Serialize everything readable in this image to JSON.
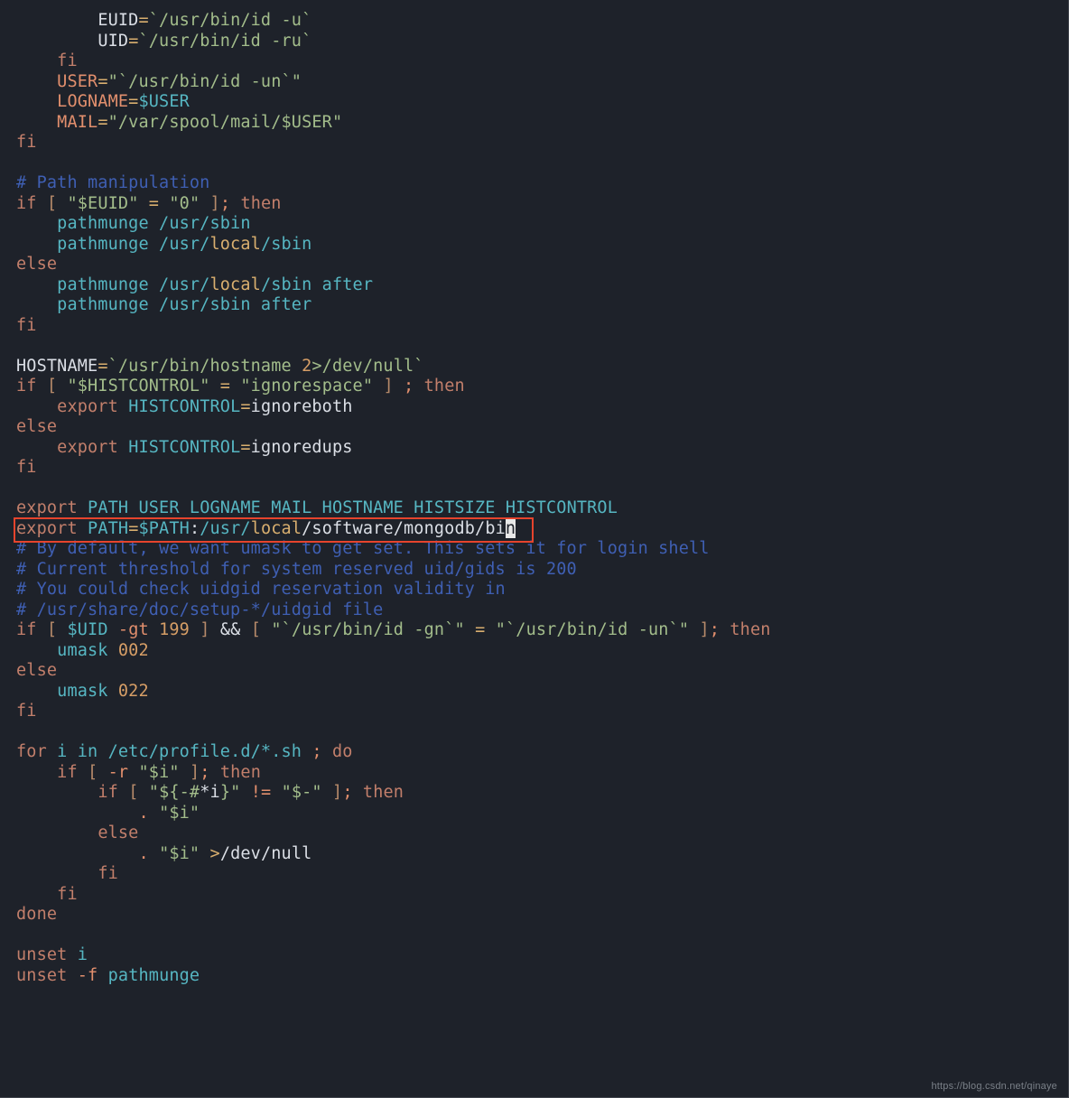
{
  "colors": {
    "background": "#1e222a",
    "keyword": "#c27f6b",
    "string": "#a3bd8b",
    "teal": "#56b6c2",
    "number": "#d69e66",
    "comment": "#3f5fb3",
    "yellow": "#d9af6f",
    "highlight_border": "#e6442d"
  },
  "watermark": "https://blog.csdn.net/qinaye",
  "highlight_box": {
    "top_line": 27,
    "left_ch": 0,
    "width_ch": 55
  },
  "lines": [
    {
      "indent": 8,
      "tokens": [
        [
          "id",
          "EUID"
        ],
        [
          "yl",
          "="
        ],
        [
          "str",
          "`/usr/bin/id -u`"
        ]
      ]
    },
    {
      "indent": 8,
      "tokens": [
        [
          "id",
          "UID"
        ],
        [
          "yl",
          "="
        ],
        [
          "str",
          "`/usr/bin/id -ru`"
        ]
      ]
    },
    {
      "indent": 4,
      "tokens": [
        [
          "kw",
          "fi"
        ]
      ]
    },
    {
      "indent": 4,
      "tokens": [
        [
          "tan",
          "USER"
        ],
        [
          "yl",
          "="
        ],
        [
          "str",
          "\"`/usr/bin/id -un`\""
        ]
      ]
    },
    {
      "indent": 4,
      "tokens": [
        [
          "tan",
          "LOGNAME"
        ],
        [
          "yl",
          "="
        ],
        [
          "teal",
          "$USER"
        ]
      ]
    },
    {
      "indent": 4,
      "tokens": [
        [
          "tan",
          "MAIL"
        ],
        [
          "yl",
          "="
        ],
        [
          "str",
          "\"/var/spool/mail/$USER\""
        ]
      ]
    },
    {
      "indent": 0,
      "tokens": [
        [
          "kw",
          "fi"
        ]
      ]
    },
    {
      "indent": 0,
      "tokens": []
    },
    {
      "indent": 0,
      "tokens": [
        [
          "cmt",
          "# Path manipulation"
        ]
      ]
    },
    {
      "indent": 0,
      "tokens": [
        [
          "kw",
          "if"
        ],
        [
          "pl",
          " "
        ],
        [
          "br",
          "["
        ],
        [
          "pl",
          " "
        ],
        [
          "str",
          "\"$EUID\""
        ],
        [
          "pl",
          " "
        ],
        [
          "yl",
          "="
        ],
        [
          "pl",
          " "
        ],
        [
          "str",
          "\"0\""
        ],
        [
          "pl",
          " "
        ],
        [
          "br",
          "]"
        ],
        [
          "tan",
          ";"
        ],
        [
          "pl",
          " "
        ],
        [
          "kw",
          "then"
        ]
      ]
    },
    {
      "indent": 4,
      "tokens": [
        [
          "teal",
          "pathmunge /usr/sbin"
        ]
      ]
    },
    {
      "indent": 4,
      "tokens": [
        [
          "teal",
          "pathmunge /usr/"
        ],
        [
          "yl",
          "local"
        ],
        [
          "teal",
          "/sbin"
        ]
      ]
    },
    {
      "indent": 0,
      "tokens": [
        [
          "kw",
          "else"
        ]
      ]
    },
    {
      "indent": 4,
      "tokens": [
        [
          "teal",
          "pathmunge /usr/"
        ],
        [
          "yl",
          "local"
        ],
        [
          "teal",
          "/sbin after"
        ]
      ]
    },
    {
      "indent": 4,
      "tokens": [
        [
          "teal",
          "pathmunge /usr/sbin after"
        ]
      ]
    },
    {
      "indent": 0,
      "tokens": [
        [
          "kw",
          "fi"
        ]
      ]
    },
    {
      "indent": 0,
      "tokens": []
    },
    {
      "indent": 0,
      "tokens": [
        [
          "id",
          "HOSTNAME"
        ],
        [
          "yl",
          "="
        ],
        [
          "str",
          "`/usr/bin/hostname "
        ],
        [
          "num",
          "2"
        ],
        [
          "str",
          ">/dev/null`"
        ]
      ]
    },
    {
      "indent": 0,
      "tokens": [
        [
          "kw",
          "if"
        ],
        [
          "pl",
          " "
        ],
        [
          "br",
          "["
        ],
        [
          "pl",
          " "
        ],
        [
          "str",
          "\"$HISTCONTROL\""
        ],
        [
          "pl",
          " "
        ],
        [
          "yl",
          "="
        ],
        [
          "pl",
          " "
        ],
        [
          "str",
          "\"ignorespace\""
        ],
        [
          "pl",
          " "
        ],
        [
          "br",
          "]"
        ],
        [
          "pl",
          " "
        ],
        [
          "tan",
          ";"
        ],
        [
          "pl",
          " "
        ],
        [
          "kw",
          "then"
        ]
      ]
    },
    {
      "indent": 4,
      "tokens": [
        [
          "kw",
          "export"
        ],
        [
          "pl",
          " "
        ],
        [
          "teal",
          "HISTCONTROL"
        ],
        [
          "yl",
          "="
        ],
        [
          "id",
          "ignoreboth"
        ]
      ]
    },
    {
      "indent": 0,
      "tokens": [
        [
          "kw",
          "else"
        ]
      ]
    },
    {
      "indent": 4,
      "tokens": [
        [
          "kw",
          "export"
        ],
        [
          "pl",
          " "
        ],
        [
          "teal",
          "HISTCONTROL"
        ],
        [
          "yl",
          "="
        ],
        [
          "id",
          "ignoredups"
        ]
      ]
    },
    {
      "indent": 0,
      "tokens": [
        [
          "kw",
          "fi"
        ]
      ]
    },
    {
      "indent": 0,
      "tokens": []
    },
    {
      "indent": 0,
      "tokens": [
        [
          "kw",
          "export"
        ],
        [
          "pl",
          " "
        ],
        [
          "teal",
          "PATH USER LOGNAME MAIL HOSTNAME HISTSIZE HISTCONTROL"
        ]
      ]
    },
    {
      "indent": 0,
      "tokens": [
        [
          "kw",
          "export"
        ],
        [
          "pl",
          " "
        ],
        [
          "teal",
          "PATH"
        ],
        [
          "yl",
          "="
        ],
        [
          "teal",
          "$PATH"
        ],
        [
          "id",
          ":"
        ],
        [
          "teal",
          "/usr/"
        ],
        [
          "yl",
          "local"
        ],
        [
          "id",
          "/software/mongodb/bi"
        ],
        [
          "cursor",
          "n"
        ]
      ]
    },
    {
      "indent": 0,
      "tokens": [
        [
          "cmt",
          "# By default, we want umask to get set. This sets it for login shell"
        ]
      ]
    },
    {
      "indent": 0,
      "tokens": [
        [
          "cmt",
          "# Current threshold for system reserved uid/gids is 200"
        ]
      ]
    },
    {
      "indent": 0,
      "tokens": [
        [
          "cmt",
          "# You could check uidgid reservation validity in"
        ]
      ]
    },
    {
      "indent": 0,
      "tokens": [
        [
          "cmt",
          "# /usr/share/doc/setup-*/uidgid file"
        ]
      ]
    },
    {
      "indent": 0,
      "tokens": [
        [
          "kw",
          "if"
        ],
        [
          "pl",
          " "
        ],
        [
          "br",
          "["
        ],
        [
          "pl",
          " "
        ],
        [
          "teal",
          "$UID"
        ],
        [
          "pl",
          " "
        ],
        [
          "tan",
          "-gt"
        ],
        [
          "pl",
          " "
        ],
        [
          "num",
          "199"
        ],
        [
          "pl",
          " "
        ],
        [
          "br",
          "]"
        ],
        [
          "pl",
          " "
        ],
        [
          "id",
          "&&"
        ],
        [
          "pl",
          " "
        ],
        [
          "br",
          "["
        ],
        [
          "pl",
          " "
        ],
        [
          "str",
          "\"`/usr/bin/id -gn`\""
        ],
        [
          "pl",
          " "
        ],
        [
          "yl",
          "="
        ],
        [
          "pl",
          " "
        ],
        [
          "str",
          "\"`/usr/bin/id -un`\""
        ],
        [
          "pl",
          " "
        ],
        [
          "br",
          "]"
        ],
        [
          "tan",
          ";"
        ],
        [
          "pl",
          " "
        ],
        [
          "kw",
          "then"
        ]
      ]
    },
    {
      "indent": 4,
      "tokens": [
        [
          "teal",
          "umask "
        ],
        [
          "num",
          "002"
        ]
      ]
    },
    {
      "indent": 0,
      "tokens": [
        [
          "kw",
          "else"
        ]
      ]
    },
    {
      "indent": 4,
      "tokens": [
        [
          "teal",
          "umask "
        ],
        [
          "num",
          "022"
        ]
      ]
    },
    {
      "indent": 0,
      "tokens": [
        [
          "kw",
          "fi"
        ]
      ]
    },
    {
      "indent": 0,
      "tokens": []
    },
    {
      "indent": 0,
      "tokens": [
        [
          "kw",
          "for"
        ],
        [
          "pl",
          " "
        ],
        [
          "teal",
          "i in /etc/profile.d/*.sh "
        ],
        [
          "tan",
          ";"
        ],
        [
          "pl",
          " "
        ],
        [
          "kw",
          "do"
        ]
      ]
    },
    {
      "indent": 4,
      "tokens": [
        [
          "kw",
          "if"
        ],
        [
          "pl",
          " "
        ],
        [
          "br",
          "["
        ],
        [
          "pl",
          " "
        ],
        [
          "tan",
          "-r"
        ],
        [
          "pl",
          " "
        ],
        [
          "str",
          "\"$i\""
        ],
        [
          "pl",
          " "
        ],
        [
          "br",
          "]"
        ],
        [
          "tan",
          ";"
        ],
        [
          "pl",
          " "
        ],
        [
          "kw",
          "then"
        ]
      ]
    },
    {
      "indent": 8,
      "tokens": [
        [
          "kw",
          "if"
        ],
        [
          "pl",
          " "
        ],
        [
          "br",
          "["
        ],
        [
          "pl",
          " "
        ],
        [
          "str",
          "\"${-#"
        ],
        [
          "id",
          "*i"
        ],
        [
          "str",
          "}\""
        ],
        [
          "pl",
          " "
        ],
        [
          "tan",
          "!="
        ],
        [
          "pl",
          " "
        ],
        [
          "str",
          "\"$-\""
        ],
        [
          "pl",
          " "
        ],
        [
          "br",
          "]"
        ],
        [
          "tan",
          ";"
        ],
        [
          "pl",
          " "
        ],
        [
          "kw",
          "then"
        ]
      ]
    },
    {
      "indent": 12,
      "tokens": [
        [
          "tan",
          "."
        ],
        [
          "pl",
          " "
        ],
        [
          "str",
          "\"$i\""
        ]
      ]
    },
    {
      "indent": 8,
      "tokens": [
        [
          "kw",
          "else"
        ]
      ]
    },
    {
      "indent": 12,
      "tokens": [
        [
          "tan",
          "."
        ],
        [
          "pl",
          " "
        ],
        [
          "str",
          "\"$i\""
        ],
        [
          "pl",
          " "
        ],
        [
          "yl",
          ">"
        ],
        [
          "id",
          "/dev/null"
        ]
      ]
    },
    {
      "indent": 8,
      "tokens": [
        [
          "kw",
          "fi"
        ]
      ]
    },
    {
      "indent": 4,
      "tokens": [
        [
          "kw",
          "fi"
        ]
      ]
    },
    {
      "indent": 0,
      "tokens": [
        [
          "kw",
          "done"
        ]
      ]
    },
    {
      "indent": 0,
      "tokens": []
    },
    {
      "indent": 0,
      "tokens": [
        [
          "kw",
          "unset"
        ],
        [
          "pl",
          " "
        ],
        [
          "teal",
          "i"
        ]
      ]
    },
    {
      "indent": 0,
      "tokens": [
        [
          "kw",
          "unset"
        ],
        [
          "pl",
          " "
        ],
        [
          "tan",
          "-f"
        ],
        [
          "pl",
          " "
        ],
        [
          "teal",
          "pathmunge"
        ]
      ]
    }
  ]
}
